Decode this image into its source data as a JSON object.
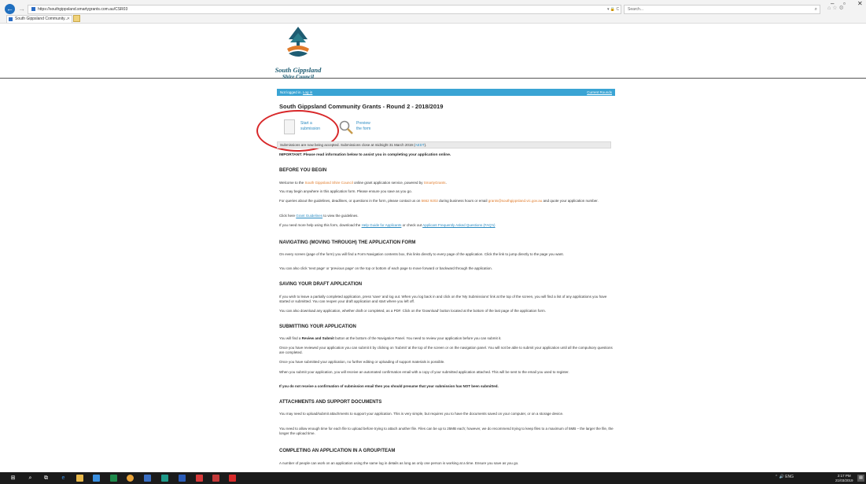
{
  "browser": {
    "url": "https://southgippsland.smartygrants.com.au/CSR03",
    "url_actions": "▾ 🔒 C",
    "search_placeholder": "Search...",
    "tab_title": "South Gippsland Community..."
  },
  "logo": {
    "line1": "South Gippsland",
    "line2": "Shire Council"
  },
  "status_bar": {
    "logged_text": "Not logged in.",
    "login_link": "Log in",
    "right_link": "Current Rounds"
  },
  "page_title": "South Gippsland Community Grants - Round 2 - 2018/2019",
  "actions": {
    "start_line1": "Start a",
    "start_line2": "submission",
    "preview_line1": "Preview",
    "preview_line2": "the form"
  },
  "notice": {
    "text": "Submissions are now being accepted. Submissions close at midnight 31 March 2019 (",
    "tz": "AEDT",
    "close": ")."
  },
  "important": "IMPORTANT: Please read information below to assist you in completing your application online.",
  "sections": {
    "before": {
      "heading": "BEFORE YOU BEGIN",
      "p1_a": "Welcome to the ",
      "p1_council": "South Gippsland Shire Council",
      "p1_b": " online grant application service, powered by ",
      "p1_smarty": "SmartyGrants",
      "p1_c": ".",
      "p2": "You may begin anywhere in this application form. Please ensure you save as you go.",
      "p3_a": "For queries about the guidelines, deadlines, or questions in the form, please contact us on ",
      "p3_phone": "5662 9202",
      "p3_b": " during business hours or email ",
      "p3_email": "grants@southgippsland.vic.gov.au",
      "p3_c": " and quote your application number.",
      "p4_a": "Click here ",
      "p4_link": "Grant Guidelines",
      "p4_b": " to view the guidelines.",
      "p5_a": "If you need more help using this form, download the ",
      "p5_link1": "Help Guide for Applicants",
      "p5_b": " or check out ",
      "p5_link2": "Applicant Frequently Asked Questions (FAQ's)"
    },
    "navigating": {
      "heading": "NAVIGATING (MOVING THROUGH) THE APPLICATION FORM",
      "p1": "On every screen (page of the form) you will find a Form Navigation contents box, this links directly to every page of the application. Click the link to jump directly to the page you want.",
      "p2": "You can also click 'next page' or 'previous page' on the top or bottom of each page to move forward or backward through the application."
    },
    "saving": {
      "heading": "SAVING YOUR DRAFT APPLICATION",
      "p1": "If you wish to leave a partially completed application, press 'save' and log out. When you log back in and click on the 'My Submissions' link at the top of the screen, you will find a list of any applications you have started or submitted. You can reopen your draft application and start where you left off.",
      "p2": "You can also download any application, whether draft or completed, as a PDF. Click on the 'Download' button located at the bottom of the last page of the application form."
    },
    "submitting": {
      "heading": "SUBMITTING YOUR APPLICATION",
      "p1_a": "You will find a ",
      "p1_bold": "Review and Submit",
      "p1_b": " button at the bottom of the Navigation Panel. You need to review your application before you can submit it.",
      "p2": "Once you have reviewed your application you can submit it by clicking on 'Submit' at the top of the screen or on the navigation panel. You will not be able to submit your application until all the compulsory questions are completed.",
      "p3": "Once you have submitted your application, no further editing or uploading of support materials is possible.",
      "p4": "When you submit your application, you will receive an automated confirmation email with a copy of your submitted application attached. This will be sent to the email you used to register.",
      "p5": "If you do not receive a confirmation of submission email then you should presume that your submission has NOT been submitted."
    },
    "attachments": {
      "heading": "ATTACHMENTS AND SUPPORT DOCUMENTS",
      "p1": "You may need to upload/submit attachments to support your application. This is very simple, but requires you to have the documents saved on your computer, or on a storage device.",
      "p2": "You need to allow enough time for each file to upload before trying to attach another file. Files can be up to 25MB each; however, we do recommend trying to keep files to a maximum of 5MB – the larger the file, the longer the upload time."
    },
    "group": {
      "heading": "COMPLETING AN APPLICATION IN A GROUP/TEAM",
      "p1": "A number of people can work on an application using the same log in details as long as only one person is working at a time. Ensure you save as you go."
    }
  },
  "taskbar": {
    "tray": "⌃ 🔊 ENG",
    "time": "2:17 PM",
    "date": "21/03/2019"
  },
  "colors": {
    "status_bar": "#3aa4d4",
    "link": "#2a8bc2",
    "orange": "#e07b2a",
    "highlight": "#d8282a",
    "logo_text": "#1e5c72"
  }
}
